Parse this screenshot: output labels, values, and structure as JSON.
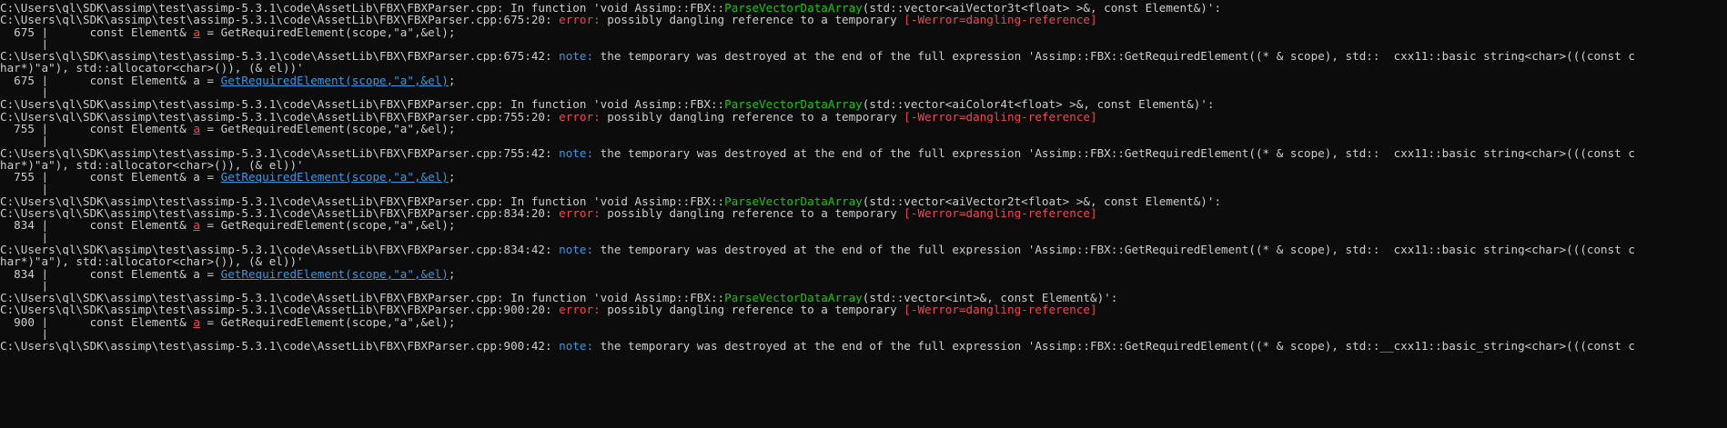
{
  "terminal": {
    "lines": [
      [
        {
          "t": "C:\\Users\\ql\\SDK\\assimp\\test\\assimp-5.3.1\\code\\AssetLib\\FBX\\FBXParser.cpp: In function 'void Assimp::FBX::"
        },
        {
          "t": "ParseVectorDataArray",
          "c": "fn"
        },
        {
          "t": "(std::vector<aiVector3t<float> >&, const Element&)':"
        }
      ],
      [
        {
          "t": "C:\\Users\\ql\\SDK\\assimp\\test\\assimp-5.3.1\\code\\AssetLib\\FBX\\FBXParser.cpp:675:20: "
        },
        {
          "t": "error:",
          "c": "error"
        },
        {
          "t": " possibly dangling reference to a temporary "
        },
        {
          "t": "[-Werror=dangling-reference]",
          "c": "flag"
        }
      ],
      [
        {
          "t": "  675 |      const Element& "
        },
        {
          "t": "a",
          "c": "caret"
        },
        {
          "t": " = GetRequiredElement(scope,\"a\",&el);"
        }
      ],
      [
        {
          "t": "      |"
        }
      ],
      [
        {
          "t": "C:\\Users\\ql\\SDK\\assimp\\test\\assimp-5.3.1\\code\\AssetLib\\FBX\\FBXParser.cpp:675:42: "
        },
        {
          "t": "note:",
          "c": "note"
        },
        {
          "t": " the temporary was destroyed at the end of the full expression 'Assimp::FBX::GetRequiredElement((* & scope), std::__cxx11::basic_string<char>(((const c"
        }
      ],
      [
        {
          "t": "har*)\"a\"), std::allocator<char>()), (& el))'"
        }
      ],
      [
        {
          "t": "  675 |      const Element& a = "
        },
        {
          "t": "GetRequiredElement(scope,\"a\",&el)",
          "c": "ul"
        },
        {
          "t": ";"
        }
      ],
      [
        {
          "t": "      |"
        }
      ],
      [
        {
          "t": "C:\\Users\\ql\\SDK\\assimp\\test\\assimp-5.3.1\\code\\AssetLib\\FBX\\FBXParser.cpp: In function 'void Assimp::FBX::"
        },
        {
          "t": "ParseVectorDataArray",
          "c": "fn"
        },
        {
          "t": "(std::vector<aiColor4t<float> >&, const Element&)':"
        }
      ],
      [
        {
          "t": "C:\\Users\\ql\\SDK\\assimp\\test\\assimp-5.3.1\\code\\AssetLib\\FBX\\FBXParser.cpp:755:20: "
        },
        {
          "t": "error:",
          "c": "error"
        },
        {
          "t": " possibly dangling reference to a temporary "
        },
        {
          "t": "[-Werror=dangling-reference]",
          "c": "flag"
        }
      ],
      [
        {
          "t": "  755 |      const Element& "
        },
        {
          "t": "a",
          "c": "caret"
        },
        {
          "t": " = GetRequiredElement(scope,\"a\",&el);"
        }
      ],
      [
        {
          "t": "      |"
        }
      ],
      [
        {
          "t": "C:\\Users\\ql\\SDK\\assimp\\test\\assimp-5.3.1\\code\\AssetLib\\FBX\\FBXParser.cpp:755:42: "
        },
        {
          "t": "note:",
          "c": "note"
        },
        {
          "t": " the temporary was destroyed at the end of the full expression 'Assimp::FBX::GetRequiredElement((* & scope), std::__cxx11::basic_string<char>(((const c"
        }
      ],
      [
        {
          "t": "har*)\"a\"), std::allocator<char>()), (& el))'"
        }
      ],
      [
        {
          "t": "  755 |      const Element& a = "
        },
        {
          "t": "GetRequiredElement(scope,\"a\",&el)",
          "c": "ul"
        },
        {
          "t": ";"
        }
      ],
      [
        {
          "t": "      |"
        }
      ],
      [
        {
          "t": "C:\\Users\\ql\\SDK\\assimp\\test\\assimp-5.3.1\\code\\AssetLib\\FBX\\FBXParser.cpp: In function 'void Assimp::FBX::"
        },
        {
          "t": "ParseVectorDataArray",
          "c": "fn"
        },
        {
          "t": "(std::vector<aiVector2t<float> >&, const Element&)':"
        }
      ],
      [
        {
          "t": "C:\\Users\\ql\\SDK\\assimp\\test\\assimp-5.3.1\\code\\AssetLib\\FBX\\FBXParser.cpp:834:20: "
        },
        {
          "t": "error:",
          "c": "error"
        },
        {
          "t": " possibly dangling reference to a temporary "
        },
        {
          "t": "[-Werror=dangling-reference]",
          "c": "flag"
        }
      ],
      [
        {
          "t": "  834 |      const Element& "
        },
        {
          "t": "a",
          "c": "caret"
        },
        {
          "t": " = GetRequiredElement(scope,\"a\",&el);"
        }
      ],
      [
        {
          "t": "      |"
        }
      ],
      [
        {
          "t": "C:\\Users\\ql\\SDK\\assimp\\test\\assimp-5.3.1\\code\\AssetLib\\FBX\\FBXParser.cpp:834:42: "
        },
        {
          "t": "note:",
          "c": "note"
        },
        {
          "t": " the temporary was destroyed at the end of the full expression 'Assimp::FBX::GetRequiredElement((* & scope), std::__cxx11::basic_string<char>(((const c"
        }
      ],
      [
        {
          "t": "har*)\"a\"), std::allocator<char>()), (& el))'"
        }
      ],
      [
        {
          "t": "  834 |      const Element& a = "
        },
        {
          "t": "GetRequiredElement(scope,\"a\",&el)",
          "c": "ul"
        },
        {
          "t": ";"
        }
      ],
      [
        {
          "t": "      |"
        }
      ],
      [
        {
          "t": "C:\\Users\\ql\\SDK\\assimp\\test\\assimp-5.3.1\\code\\AssetLib\\FBX\\FBXParser.cpp: In function 'void Assimp::FBX::"
        },
        {
          "t": "ParseVectorDataArray",
          "c": "fn"
        },
        {
          "t": "(std::vector<int>&, const Element&)':"
        }
      ],
      [
        {
          "t": "C:\\Users\\ql\\SDK\\assimp\\test\\assimp-5.3.1\\code\\AssetLib\\FBX\\FBXParser.cpp:900:20: "
        },
        {
          "t": "error:",
          "c": "error"
        },
        {
          "t": " possibly dangling reference to a temporary "
        },
        {
          "t": "[-Werror=dangling-reference]",
          "c": "flag"
        }
      ],
      [
        {
          "t": "  900 |      const Element& "
        },
        {
          "t": "a",
          "c": "caret"
        },
        {
          "t": " = GetRequiredElement(scope,\"a\",&el);"
        }
      ],
      [
        {
          "t": "      |"
        }
      ],
      [
        {
          "t": "C:\\Users\\ql\\SDK\\assimp\\test\\assimp-5.3.1\\code\\AssetLib\\FBX\\FBXParser.cpp:900:42: "
        },
        {
          "t": "note:",
          "c": "note"
        },
        {
          "t": " the temporary was destroyed at the end of the full expression 'Assimp::FBX::GetRequiredElement((* & scope), std::__cxx11::basic_string<char>(((const c"
        }
      ]
    ]
  }
}
